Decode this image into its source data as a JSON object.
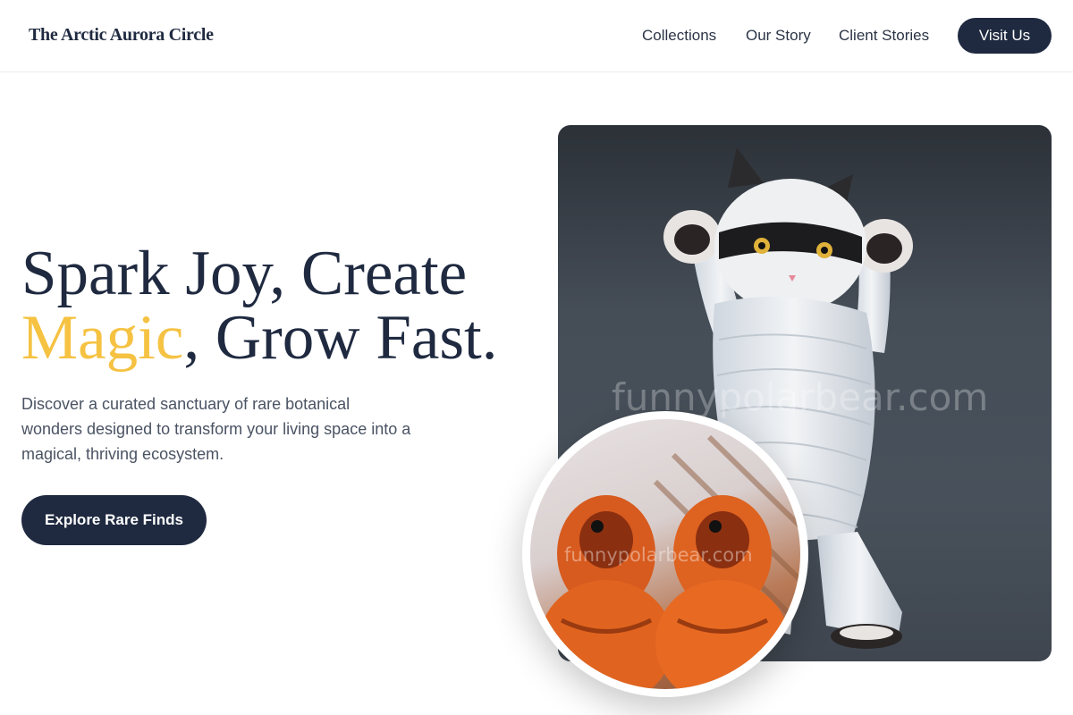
{
  "header": {
    "brand": "The Arctic Aurora Circle",
    "nav": [
      "Collections",
      "Our Story",
      "Client Stories"
    ],
    "visit_label": "Visit Us"
  },
  "hero": {
    "headline_line1": "Spark Joy, Create",
    "headline_accent": "Magic",
    "headline_rest": ", Grow Fast.",
    "intro": "Discover a curated sanctuary of rare botanical wonders designed to transform your living space into a magical, thriving ecosystem.",
    "cta_label": "Explore Rare Finds"
  },
  "images": {
    "main_watermark": "funnypolarbear.com",
    "inset_watermark": "funnypolarbear.com"
  },
  "colors": {
    "primary": "#1f2a40",
    "accent": "#f5c242"
  }
}
